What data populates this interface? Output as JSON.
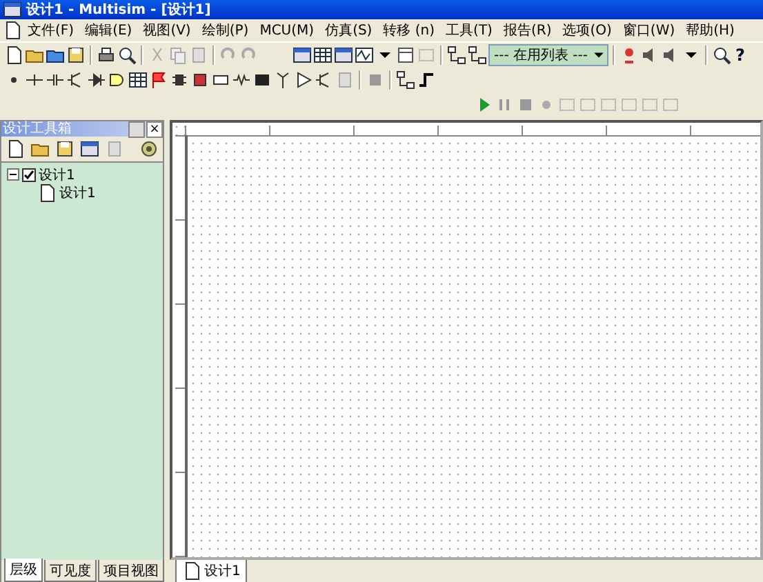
{
  "window": {
    "title": "设计1 - Multisim - [设计1]"
  },
  "menu": [
    "文件(F)",
    "编辑(E)",
    "视图(V)",
    "绘制(P)",
    "MCU(M)",
    "仿真(S)",
    "转移 (n)",
    "工具(T)",
    "报告(R)",
    "选项(O)",
    "窗口(W)",
    "帮助(H)"
  ],
  "toolbar": {
    "in_use_list": "--- 在用列表 ---",
    "help_glyph": "?"
  },
  "design_toolbox": {
    "title": "设计工具箱",
    "close_glyph": "×",
    "tree": [
      {
        "label": "设计1",
        "expanded": true,
        "checked": true,
        "children": [
          {
            "label": "设计1"
          }
        ]
      }
    ],
    "tabs": [
      {
        "label": "层级",
        "selected": true
      },
      {
        "label": "可见度",
        "selected": false
      },
      {
        "label": "项目视图",
        "selected": false
      }
    ]
  },
  "document_tabs": [
    {
      "label": "设计1",
      "selected": true
    }
  ]
}
